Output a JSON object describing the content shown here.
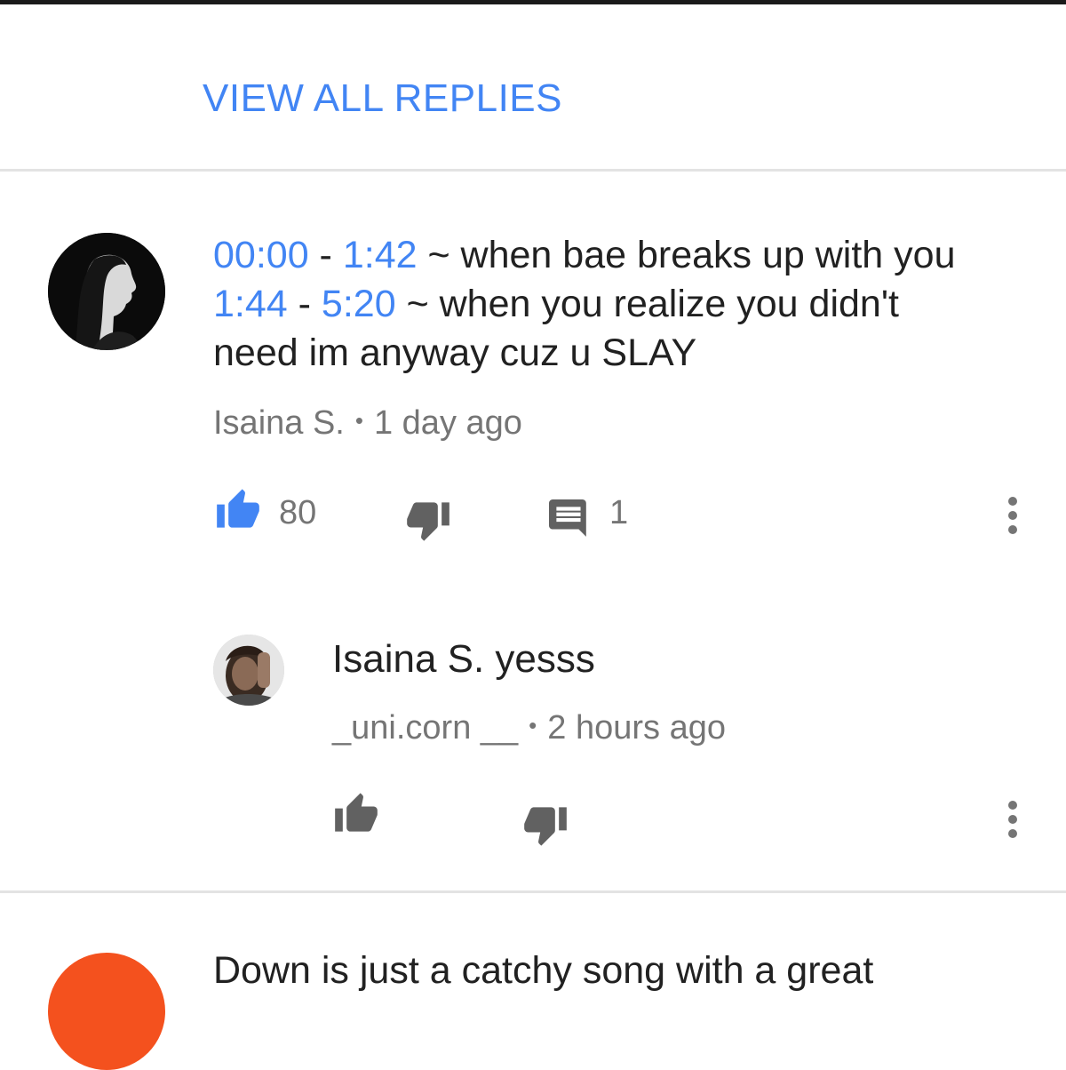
{
  "replies_link": {
    "label": "VIEW ALL REPLIES"
  },
  "comment": {
    "lines": [
      {
        "ts_start": "00:00",
        "sep": " - ",
        "ts_end": "1:42",
        "text": " ~ when bae breaks up with you"
      },
      {
        "ts_start": "1:44",
        "sep": " - ",
        "ts_end": "5:20",
        "text": " ~ when you realize you didn't"
      },
      {
        "text": "need im anyway cuz u SLAY"
      }
    ],
    "author": "Isaina S.",
    "dot": "•",
    "time": "1 day ago",
    "likes": "80",
    "replies": "1",
    "icons": {
      "like": "thumbs-up-icon",
      "dislike": "thumbs-down-icon",
      "reply": "comment-icon",
      "more": "more-vert-icon"
    },
    "colors": {
      "timestamp": "#4285f4",
      "like_active": "#4285f4",
      "icon": "#757575"
    }
  },
  "reply": {
    "text": "Isaina S. yesss",
    "author": "_uni.corn __",
    "dot": "•",
    "time": "2 hours ago"
  },
  "next_comment": {
    "partial_text": "Down is just a catchy song with a great"
  }
}
